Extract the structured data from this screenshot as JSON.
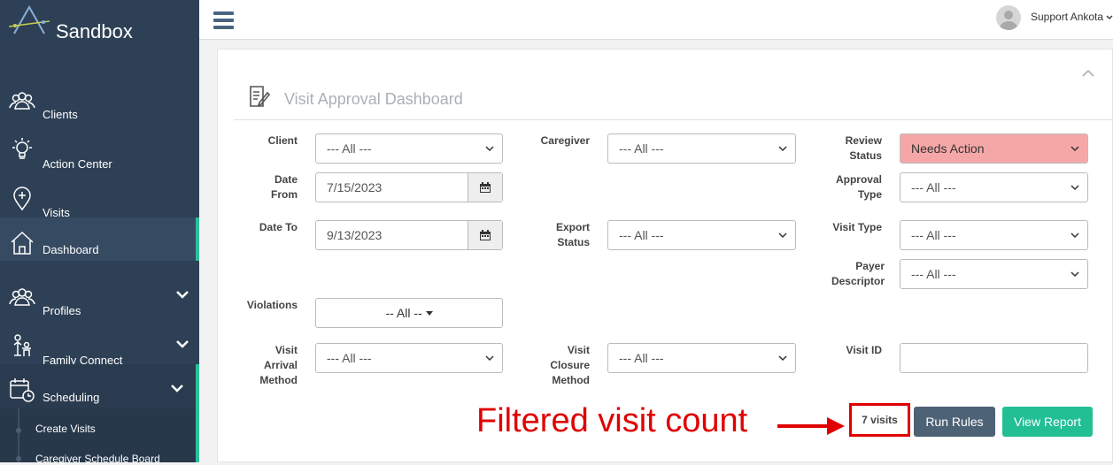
{
  "sidebar": {
    "brand": "Sandbox",
    "items": [
      {
        "label": "Clients",
        "icon": "clients-icon"
      },
      {
        "label": "Action Center",
        "icon": "lightbulb-icon"
      },
      {
        "label": "Visits",
        "icon": "visit-pin-icon"
      },
      {
        "label": "Dashboard",
        "icon": "home-icon"
      },
      {
        "label": "Profiles",
        "icon": "profiles-icon"
      },
      {
        "label": "Family Connect",
        "icon": "family-icon"
      },
      {
        "label": "Scheduling",
        "icon": "calendar-clock-icon"
      }
    ],
    "sub_items": [
      "Create Visits",
      "Caregiver Schedule Board"
    ]
  },
  "topbar": {
    "username": "Support Ankota"
  },
  "panel": {
    "title": "Visit Approval Dashboard",
    "filters": {
      "client": {
        "label": "Client",
        "value": "--- All ---"
      },
      "caregiver": {
        "label": "Caregiver",
        "value": "--- All ---"
      },
      "review_status": {
        "label_1": "Review",
        "label_2": "Status",
        "value": "Needs Action"
      },
      "date_from": {
        "label_1": "Date",
        "label_2": "From",
        "value": "7/15/2023"
      },
      "approval_type": {
        "label_1": "Approval",
        "label_2": "Type",
        "value": "--- All ---"
      },
      "date_to": {
        "label": "Date To",
        "value": "9/13/2023"
      },
      "export_status": {
        "label_1": "Export",
        "label_2": "Status",
        "value": "--- All ---"
      },
      "visit_type": {
        "label": "Visit Type",
        "value": "--- All ---"
      },
      "payer_descriptor": {
        "label_1": "Payer",
        "label_2": "Descriptor",
        "value": "--- All ---"
      },
      "violations": {
        "label": "Violations",
        "value": "-- All --"
      },
      "visit_arrival_method": {
        "label_1": "Visit",
        "label_2": "Arrival",
        "label_3": "Method",
        "value": "--- All ---"
      },
      "visit_closure_method": {
        "label_1": "Visit",
        "label_2": "Closure",
        "label_3": "Method",
        "value": "--- All ---"
      },
      "visit_id": {
        "label": "Visit ID",
        "value": ""
      }
    },
    "visit_count": "7 visits",
    "run_rules_label": "Run Rules",
    "view_report_label": "View Report"
  },
  "annotation": {
    "text": "Filtered visit count"
  },
  "colors": {
    "sidebar_bg": "#2e4055",
    "accent": "#2bbf9a",
    "needs_action": "#f5a7a7",
    "annotation": "#e00000"
  }
}
